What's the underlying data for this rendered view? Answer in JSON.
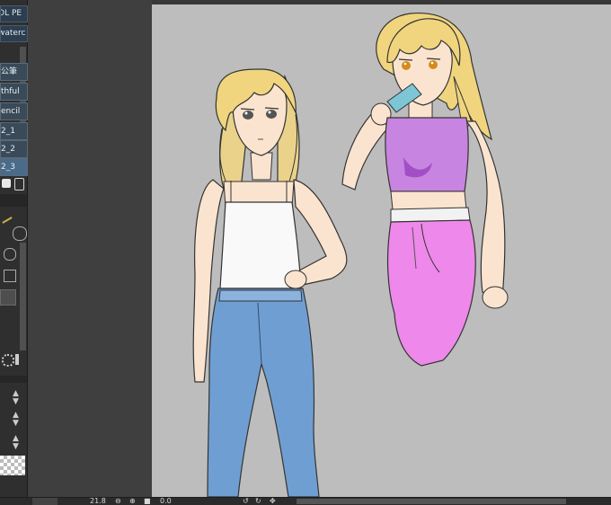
{
  "tool_panel": {
    "tabs": [
      "OL PE",
      "waterc",
      "公筆",
      "thful",
      "encil",
      "2_1",
      "2_2",
      "2_3"
    ],
    "active_tab_index": 7
  },
  "status_bar": {
    "zoom": "21.8",
    "rotation": "0.0"
  },
  "colors": {
    "canvas_bg": "#bdbdbd",
    "panel_bg": "#2f2f2f",
    "tab_bg": "#2c3e4f",
    "tab_active_bg": "#4a6b8a"
  }
}
